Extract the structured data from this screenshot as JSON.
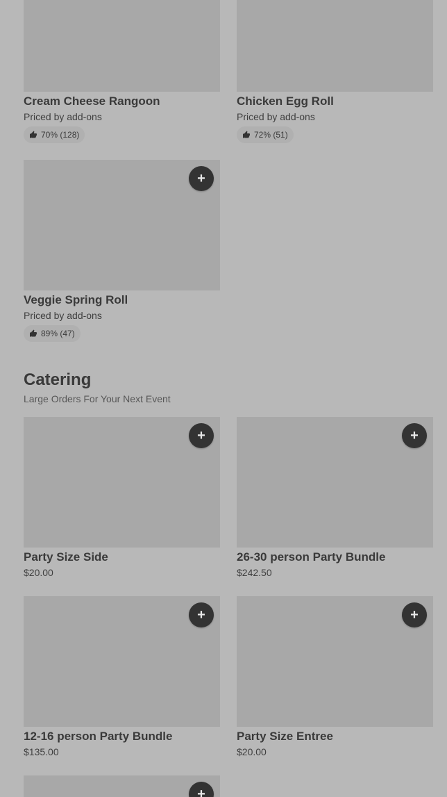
{
  "items": [
    {
      "name": "Cream Cheese Rangoon",
      "sub": "Priced by add-ons",
      "rating": "70% (128)"
    },
    {
      "name": "Chicken Egg Roll",
      "sub": "Priced by add-ons",
      "rating": "72% (51)"
    },
    {
      "name": "Veggie Spring Roll",
      "sub": "Priced by add-ons",
      "rating": "89% (47)"
    }
  ],
  "catering": {
    "title": "Catering",
    "subtitle": "Large Orders For Your Next Event",
    "items": [
      {
        "name": "Party Size Side",
        "price": "$20.00"
      },
      {
        "name": "26-30 person Party Bundle",
        "price": "$242.50"
      },
      {
        "name": "12-16 person Party Bundle",
        "price": "$135.00"
      },
      {
        "name": "Party Size Entree",
        "price": "$20.00"
      }
    ]
  },
  "add_symbol": "+",
  "colors": {
    "background": "#b8b8b8",
    "image_placeholder": "#a8a8a8",
    "add_button": "#333333",
    "rating_pill": "#b0b0b0"
  },
  "icons": {
    "add": "plus-icon",
    "rating": "thumbs-up-icon"
  }
}
